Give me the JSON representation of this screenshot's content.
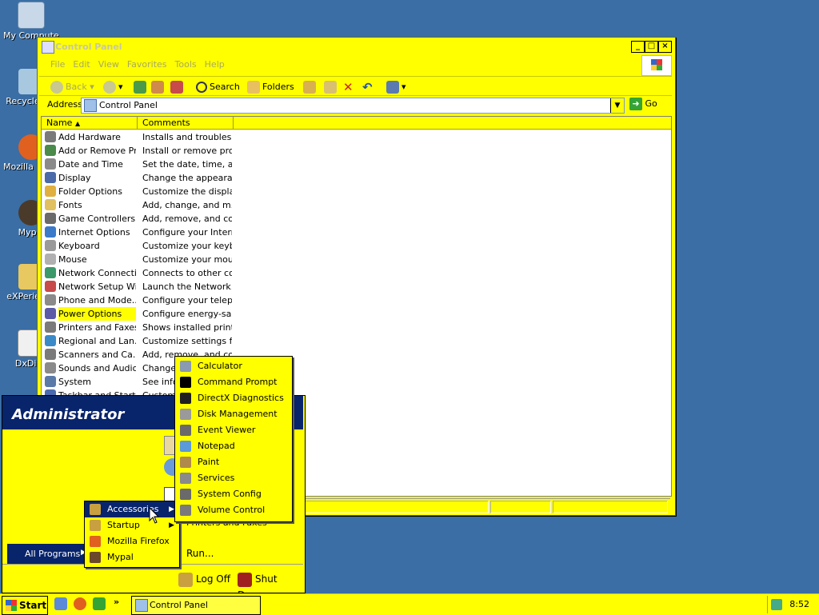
{
  "desktop": {
    "icons": [
      {
        "label": "My Computer"
      },
      {
        "label": "Recycle Bin"
      },
      {
        "label": "Mozilla Firefox"
      },
      {
        "label": "Mypal"
      },
      {
        "label": "eXPerience"
      },
      {
        "label": "DxDiag"
      }
    ]
  },
  "window": {
    "title": "Control Panel",
    "menu": [
      "File",
      "Edit",
      "View",
      "Favorites",
      "Tools",
      "Help"
    ],
    "toolbar": {
      "back": "Back",
      "search": "Search",
      "folders": "Folders"
    },
    "address": {
      "label": "Address",
      "value": "Control Panel",
      "go": "Go"
    },
    "columns": {
      "name": "Name",
      "comments": "Comments"
    },
    "items": [
      {
        "name": "Add Hardware",
        "comment": "Installs and troublesh...",
        "icon_color": "#7a7a7a"
      },
      {
        "name": "Add or Remove Pr...",
        "comment": "Install or remove pro...",
        "icon_color": "#4a8a4a"
      },
      {
        "name": "Date and Time",
        "comment": "Set the date, time, a...",
        "icon_color": "#8a8a8a"
      },
      {
        "name": "Display",
        "comment": "Change the appeara...",
        "icon_color": "#4a6aa8"
      },
      {
        "name": "Folder Options",
        "comment": "Customize the displa...",
        "icon_color": "#e0b040"
      },
      {
        "name": "Fonts",
        "comment": "Add, change, and m...",
        "icon_color": "#e0c060"
      },
      {
        "name": "Game Controllers",
        "comment": "Add, remove, and co...",
        "icon_color": "#6a6a6a"
      },
      {
        "name": "Internet Options",
        "comment": "Configure your Intern...",
        "icon_color": "#3a7ac8"
      },
      {
        "name": "Keyboard",
        "comment": "Customize your keyb...",
        "icon_color": "#9a9a9a"
      },
      {
        "name": "Mouse",
        "comment": "Customize your mous...",
        "icon_color": "#b0b0b0"
      },
      {
        "name": "Network Connecti...",
        "comment": "Connects to other co...",
        "icon_color": "#3a9a6a"
      },
      {
        "name": "Network Setup Wi...",
        "comment": "Launch the Network...",
        "icon_color": "#c84a4a"
      },
      {
        "name": "Phone and Mode...",
        "comment": "Configure your telep...",
        "icon_color": "#8a8a8a"
      },
      {
        "name": "Power Options",
        "comment": "Configure energy-sa...",
        "icon_color": "#5a5aa8"
      },
      {
        "name": "Printers and Faxes",
        "comment": "Shows installed print...",
        "icon_color": "#7a7a7a"
      },
      {
        "name": "Regional and Lan...",
        "comment": "Customize settings fo...",
        "icon_color": "#3a8ac8"
      },
      {
        "name": "Scanners and Ca...",
        "comment": "Add, remove, and co...",
        "icon_color": "#7a7a7a"
      },
      {
        "name": "Sounds and Audio...",
        "comment": "Change t",
        "icon_color": "#8a8a8a"
      },
      {
        "name": "System",
        "comment": "See infor",
        "icon_color": "#5a7aa8"
      },
      {
        "name": "Taskbar and Start...",
        "comment": "Customiz",
        "icon_color": "#4a6ab0"
      }
    ],
    "selected_index": 13
  },
  "start_menu": {
    "user": "Administrator",
    "all_programs": "All Programs",
    "right_items": {
      "printers": "Printers and Faxes",
      "run": "Run..."
    },
    "log_off": "Log Off",
    "shut_down": "Shut Down",
    "programs": [
      {
        "label": "Accessories",
        "has_arrow": true,
        "icon_color": "#c8a040"
      },
      {
        "label": "Startup",
        "has_arrow": true,
        "icon_color": "#c8a040"
      },
      {
        "label": "Mozilla Firefox",
        "has_arrow": false,
        "icon_color": "#e06020"
      },
      {
        "label": "Mypal",
        "has_arrow": false,
        "icon_color": "#6a4a2a"
      }
    ],
    "accessories": [
      {
        "label": "Calculator",
        "icon_color": "#8a9ab0"
      },
      {
        "label": "Command Prompt",
        "icon_color": "#000000"
      },
      {
        "label": "DirectX Diagnostics",
        "icon_color": "#202020"
      },
      {
        "label": "Disk Management",
        "icon_color": "#9a9a9a"
      },
      {
        "label": "Event Viewer",
        "icon_color": "#6a6a6a"
      },
      {
        "label": "Notepad",
        "icon_color": "#5a9ad8"
      },
      {
        "label": "Paint",
        "icon_color": "#b08a4a"
      },
      {
        "label": "Services",
        "icon_color": "#8a8a8a"
      },
      {
        "label": "System Config",
        "icon_color": "#6a6a6a"
      },
      {
        "label": "Volume Control",
        "icon_color": "#7a7a7a"
      }
    ]
  },
  "taskbar": {
    "start": "Start",
    "task": "Control Panel",
    "clock": "8:52",
    "overflow": "»"
  },
  "colors": {
    "theme": "#ffff00",
    "highlight": "#08246b",
    "desktop": "#3a6ea5"
  }
}
